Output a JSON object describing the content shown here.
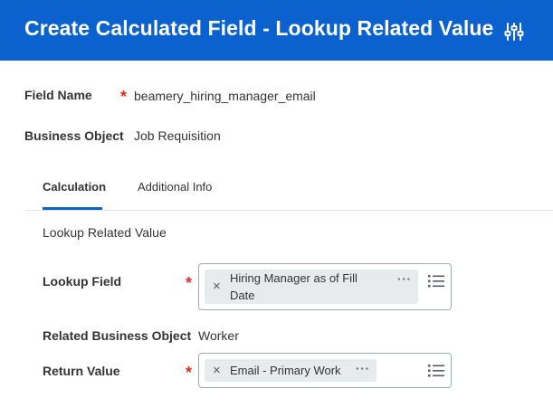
{
  "header": {
    "title": "Create Calculated Field - Lookup Related Value",
    "settings_icon": "related-actions-sliders-icon"
  },
  "fields": {
    "field_name_label": "Field Name",
    "field_name_required": "*",
    "field_name_value": "beamery_hiring_manager_email",
    "business_object_label": "Business Object",
    "business_object_value": "Job Requisition"
  },
  "tabs": [
    {
      "label": "Calculation",
      "active": true
    },
    {
      "label": "Additional Info",
      "active": false
    }
  ],
  "calculation": {
    "section_title": "Lookup Related Value",
    "lookup_field_label": "Lookup Field",
    "lookup_field_required": "*",
    "lookup_field_value_line1": "Hiring Manager as of Fill",
    "lookup_field_value_line2": "Date",
    "related_bo_label": "Related Business Object",
    "related_bo_value": "Worker",
    "return_value_label": "Return Value",
    "return_value_required": "*",
    "return_value_value": "Email - Primary Work",
    "remove_glyph": "×",
    "more_glyph": "···"
  },
  "colors": {
    "header_bg": "#0b62cf",
    "required": "#de2e21",
    "pill_bg": "#e8ebed",
    "active_tab": "#0b62cf"
  }
}
